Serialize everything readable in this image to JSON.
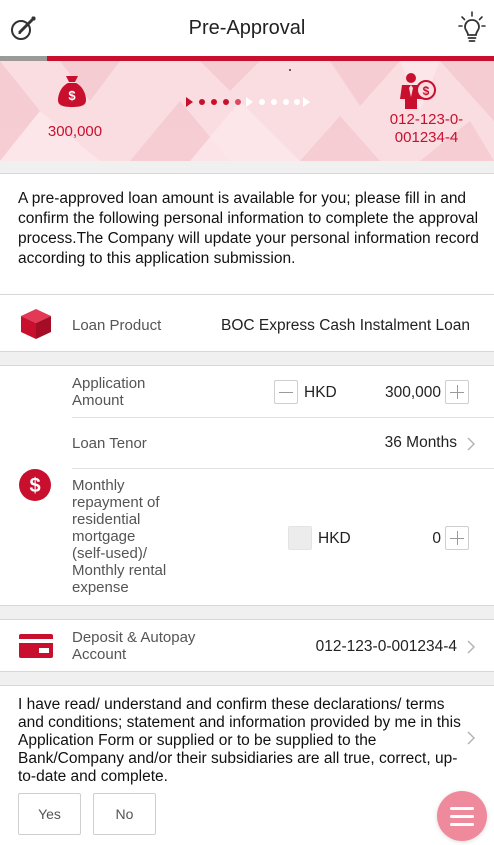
{
  "header": {
    "title": "Pre-Approval",
    "left_icon": "edit-icon",
    "right_icon": "lightbulb-icon"
  },
  "progress": {
    "fraction_complete": 0.095
  },
  "banner": {
    "amount": "300,000",
    "account_line1": "012-123-0-",
    "account_line2": "001234-4",
    "left_icon": "money-bag-icon",
    "right_icon": "person-money-icon",
    "flow_icon": "dotted-arrow-icon"
  },
  "intro_text": "A pre-approved loan amount is available for you; please fill in and confirm the following personal information to complete the approval process.The Company will update your personal information record according to this application submission.",
  "loan_product": {
    "label": "Loan Product",
    "value": "BOC Express Cash Instalment Loan",
    "icon": "box-icon"
  },
  "application": {
    "amount_label_1": "Application",
    "amount_label_2": "Amount",
    "currency": "HKD",
    "amount_value": "300,000",
    "tenor_label": "Loan Tenor",
    "tenor_value": "36 Months",
    "repayment_label_lines": [
      "Monthly",
      "repayment of",
      "residential",
      "mortgage",
      "(self-used)/",
      "Monthly rental",
      "expense"
    ],
    "repayment_currency": "HKD",
    "repayment_value": "0",
    "icon": "dollar-circle-icon"
  },
  "deposit": {
    "label_1": "Deposit & Autopay",
    "label_2": "Account",
    "value": "012-123-0-001234-4",
    "icon": "card-icon"
  },
  "declaration": {
    "text": "I have read/ understand and confirm these declarations/ terms and conditions; statement and information provided by me in this Application Form or supplied or to be supplied to the Bank/Company and/or their subsidiaries are all true, correct, up-to-date and complete.",
    "yes_label": "Yes",
    "no_label": "No"
  },
  "fab_icon": "menu-icon",
  "colors": {
    "brand_red": "#c8102e",
    "banner_bg": "#f9dde1",
    "fab": "#ef8a9d"
  }
}
